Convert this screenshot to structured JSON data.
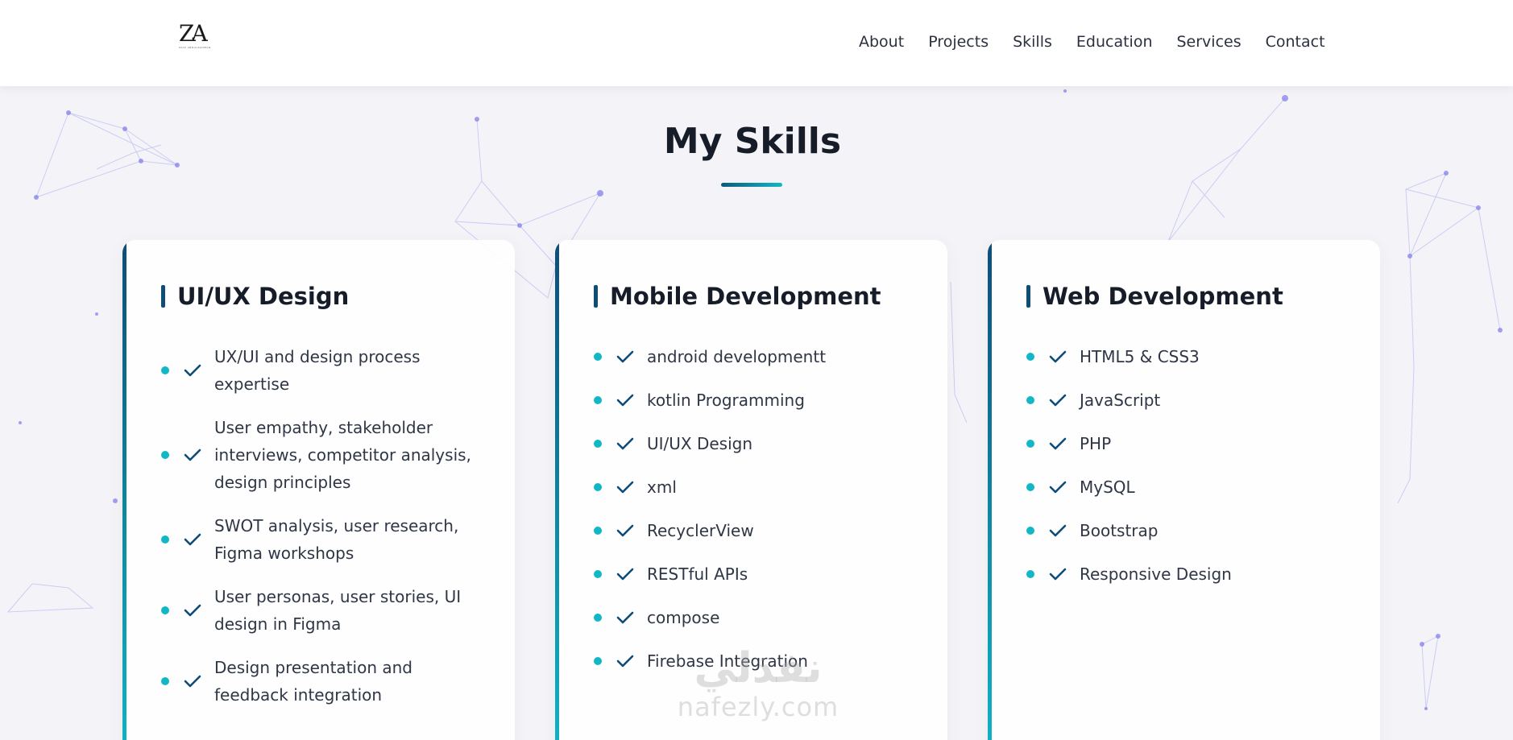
{
  "nav": {
    "logo_text": "ZA",
    "logo_subtext": "ZAID ABDULRAHMAN",
    "links": [
      "About",
      "Projects",
      "Skills",
      "Education",
      "Services",
      "Contact"
    ]
  },
  "section": {
    "title": "My Skills"
  },
  "cards": [
    {
      "title": "UI/UX Design",
      "items": [
        "UX/UI and design process expertise",
        "User empathy, stakeholder interviews, competitor analysis, design principles",
        "SWOT analysis, user research, Figma workshops",
        "User personas, user stories, UI design in Figma",
        "Design presentation and feedback integration"
      ]
    },
    {
      "title": "Mobile Development",
      "items": [
        "android developmentt",
        "kotlin Programming",
        "UI/UX Design",
        "xml",
        "RecyclerView",
        "RESTful APIs",
        "compose",
        "Firebase Integration"
      ]
    },
    {
      "title": "Web Development",
      "items": [
        "HTML5 & CSS3",
        "JavaScript",
        "PHP",
        "MySQL",
        "Bootstrap",
        "Responsive Design"
      ]
    }
  ],
  "watermark": {
    "arabic": "نفذلي",
    "latin": "nafezly.com"
  },
  "colors": {
    "accent": "#12b7c6",
    "accent_dark": "#0d4d78",
    "heading": "#161c28",
    "text": "#2f3645",
    "background": "#f4f4f8"
  }
}
